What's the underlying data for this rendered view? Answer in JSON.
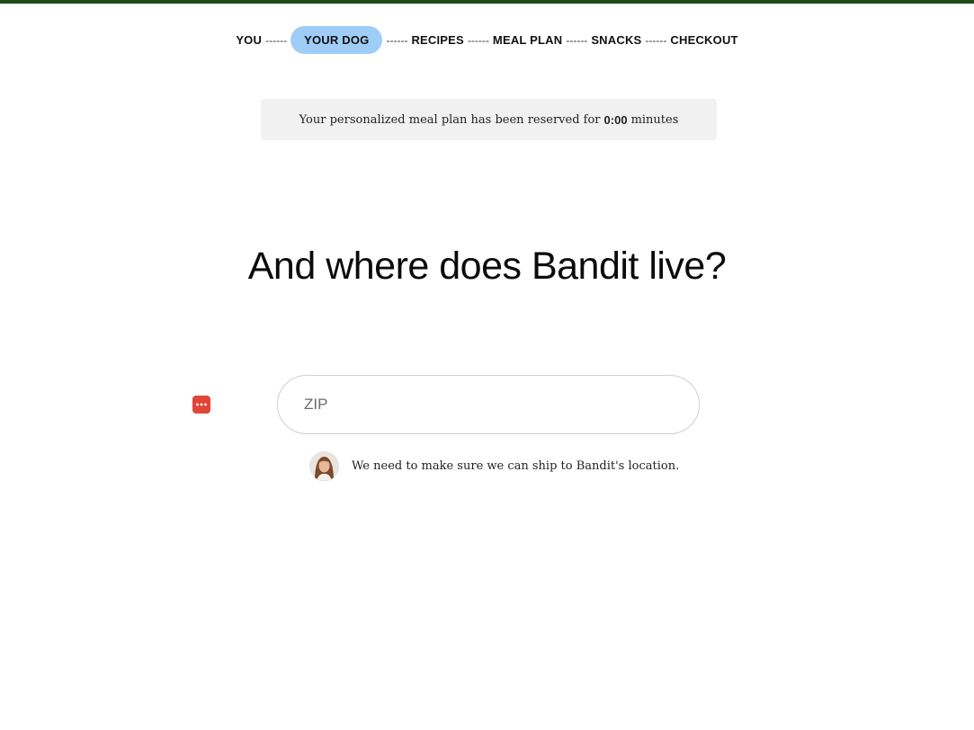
{
  "stepper": {
    "separator": "------",
    "steps": [
      {
        "label": "YOU",
        "active": false
      },
      {
        "label": "YOUR DOG",
        "active": true
      },
      {
        "label": "RECIPES",
        "active": false
      },
      {
        "label": "MEAL PLAN",
        "active": false
      },
      {
        "label": "SNACKS",
        "active": false
      },
      {
        "label": "CHECKOUT",
        "active": false
      }
    ]
  },
  "timer": {
    "prefix": "Your personalized meal plan has been reserved for",
    "value": "0:00",
    "suffix": "minutes"
  },
  "headline": "And where does Bandit live?",
  "zip_field": {
    "value": "",
    "placeholder": "ZIP"
  },
  "password_manager": {
    "icon": "password-manager-icon"
  },
  "helper": {
    "avatar_icon": "advisor-avatar",
    "text": "We need to make sure we can ship to Bandit's location."
  },
  "colors": {
    "top_bar": "#1f4a1c",
    "active_step": "#9fcdf7",
    "timer_bg": "#f1f1f1",
    "password_icon": "#e04638"
  }
}
